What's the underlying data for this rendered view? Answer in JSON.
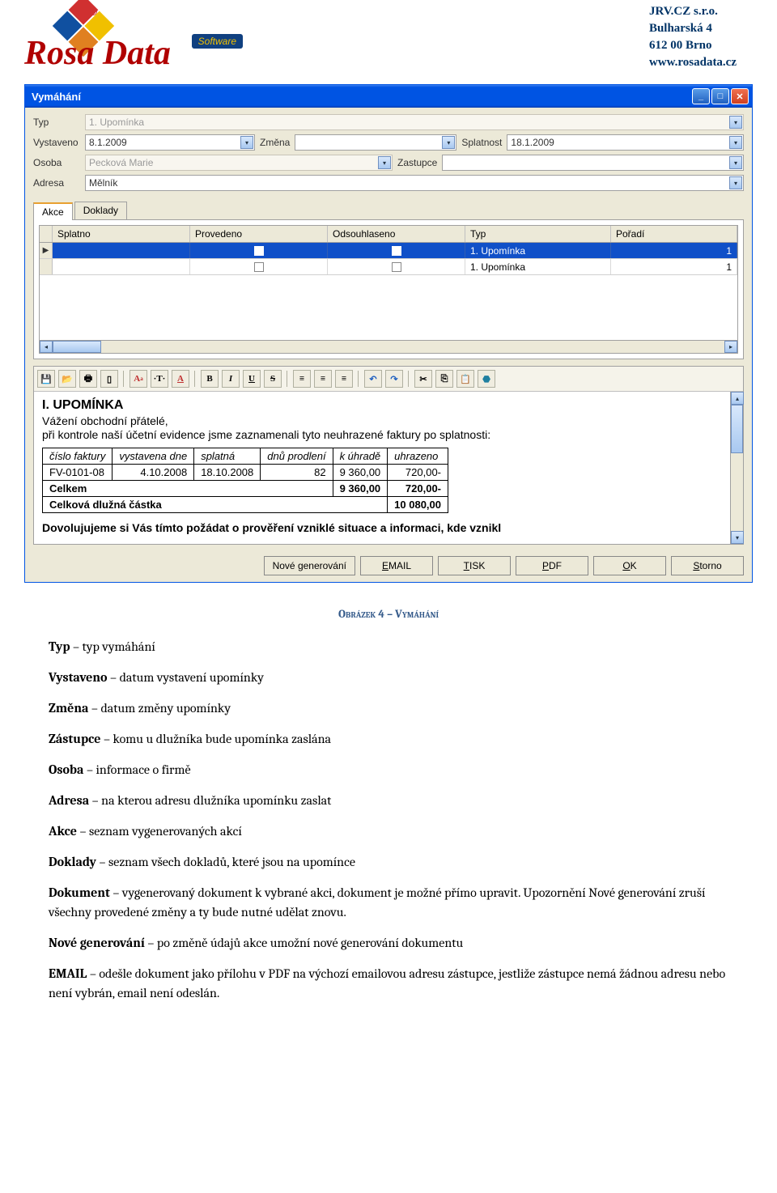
{
  "header": {
    "company_lines": [
      "JRV.CZ s.r.o.",
      "Bulharská 4",
      "612 00 Brno",
      "www.rosadata.cz"
    ],
    "logo_text": "Rosa Data",
    "logo_sw": "Software",
    "reg": "®"
  },
  "window": {
    "title": "Vymáhání",
    "fields": {
      "typ_label": "Typ",
      "typ_value": "1. Upomínka",
      "vystaveno_label": "Vystaveno",
      "vystaveno_value": "8.1.2009",
      "zmena_label": "Změna",
      "zmena_value": "",
      "splatnost_label": "Splatnost",
      "splatnost_value": "18.1.2009",
      "osoba_label": "Osoba",
      "osoba_value": "Pecková Marie",
      "zastupce_label": "Zastupce",
      "zastupce_value": "",
      "adresa_label": "Adresa",
      "adresa_value": "Mělník"
    },
    "tabs": {
      "akce": "Akce",
      "doklady": "Doklady"
    },
    "grid": {
      "cols": [
        "Splatno",
        "Provedeno",
        "Odsouhlaseno",
        "Typ",
        "Pořadí"
      ],
      "rows": [
        {
          "typ": "1. Upomínka",
          "poradi": "1",
          "selected": true
        },
        {
          "typ": "1. Upomínka",
          "poradi": "1",
          "selected": false
        }
      ]
    },
    "doc": {
      "title": "I. UPOMÍNKA",
      "line1": "Vážení obchodní přátelé,",
      "line2": "při kontrole naší účetní evidence jsme zaznamenali tyto neuhrazené faktury po splatnosti:",
      "cols": [
        "číslo faktury",
        "vystavena dne",
        "splatná",
        "dnů prodlení",
        "k úhradě",
        "uhrazeno"
      ],
      "data_row": [
        "FV-0101-08",
        "4.10.2008",
        "18.10.2008",
        "82",
        "9 360,00",
        "720,00-"
      ],
      "celkem_label": "Celkem",
      "celkem_uhrade": "9 360,00",
      "celkem_uhrazeno": "720,00-",
      "dluzna_label": "Celková dlužná částka",
      "dluzna_value": "10 080,00",
      "footer": "Dovolujujeme si Vás tímto požádat o prověření vzniklé situace a informaci, kde vznikl"
    },
    "buttons": {
      "nove": "Nové generování",
      "email": "EMAIL",
      "tisk": "TISK",
      "pdf": "PDF",
      "ok": "OK",
      "storno": "Storno"
    }
  },
  "caption": "Obrázek 4 – Vymáhání",
  "desc": {
    "typ": {
      "term": "Typ",
      "text": " – typ vymáhání"
    },
    "vyst": {
      "term": "Vystaveno",
      "text": " – datum vystavení upomínky"
    },
    "zmena": {
      "term": "Změna",
      "text": " – datum změny upomínky"
    },
    "zast": {
      "term": "Zástupce",
      "text": " – komu u dlužníka bude upomínka zaslána"
    },
    "osoba": {
      "term": "Osoba",
      "text": " – informace o firmě"
    },
    "adresa": {
      "term": "Adresa",
      "text": " – na kterou adresu dlužníka upomínku zaslat"
    },
    "akce": {
      "term": "Akce",
      "text": " – seznam vygenerovaných akcí"
    },
    "dokl": {
      "term": "Doklady",
      "text": " – seznam všech dokladů, které jsou na upomínce"
    },
    "dok": {
      "term": "Dokument",
      "text": " – vygenerovaný dokument k vybrané akci, dokument je možné přímo upravit. Upozornění Nové generování zruší všechny provedené změny a ty bude nutné udělat znovu."
    },
    "nove": {
      "term": "Nové generování",
      "text": " – po změně údajů akce umožní nové generování dokumentu"
    },
    "email": {
      "term": "EMAIL",
      "text": " – odešle dokument jako přílohu v PDF na výchozí emailovou adresu zástupce, jestliže zástupce nemá žádnou adresu nebo není vybrán, email není odeslán."
    }
  }
}
